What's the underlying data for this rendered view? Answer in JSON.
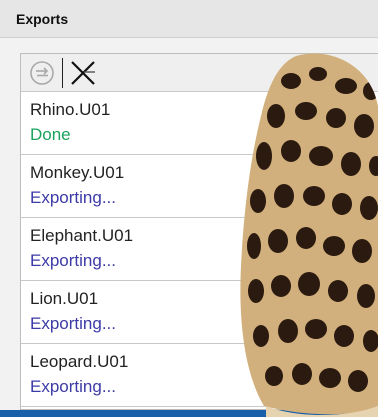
{
  "window": {
    "title": "Exports"
  },
  "toolbar": {
    "refresh_icon": "refresh-icon",
    "clear_icon": "clear-x-icon"
  },
  "exports": [
    {
      "name": "Rhino.U01",
      "status": "Done",
      "state": "done"
    },
    {
      "name": "Monkey.U01",
      "status": "Exporting...",
      "state": "exporting"
    },
    {
      "name": "Elephant.U01",
      "status": "Exporting...",
      "state": "exporting"
    },
    {
      "name": "Lion.U01",
      "status": "Exporting...",
      "state": "exporting"
    },
    {
      "name": "Leopard.U01",
      "status": "Exporting...",
      "state": "exporting"
    }
  ],
  "colors": {
    "done": "#1aa35c",
    "exporting": "#3c3aa6",
    "desktop": "#1b5fa8"
  }
}
